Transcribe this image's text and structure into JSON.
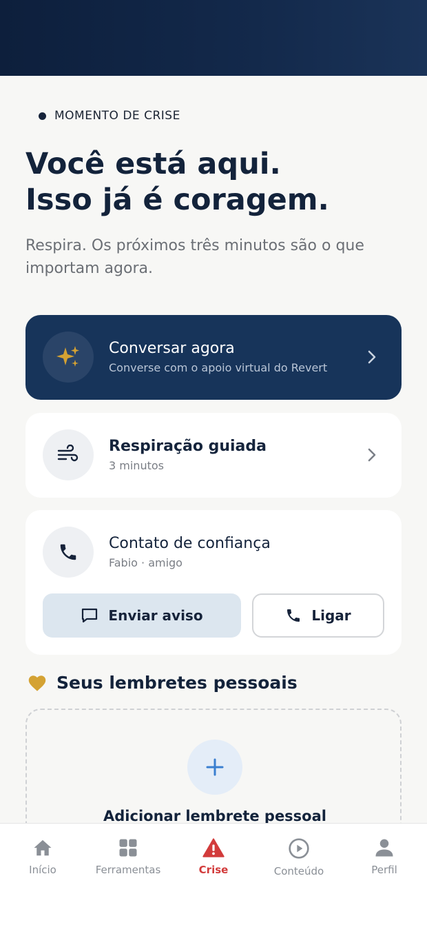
{
  "header": {
    "eyebrow": "MOMENTO DE CRISE",
    "title_line1": "Você está aqui.",
    "title_line2": "Isso já é coragem.",
    "subtitle": "Respira. Os próximos três minutos são o que importam agora."
  },
  "cards": {
    "chat": {
      "title": "Conversar agora",
      "subtitle": "Converse com o apoio virtual do Revert"
    },
    "breathing": {
      "title": "Respiração guiada",
      "subtitle": "3 minutos"
    },
    "contact": {
      "title": "Contato de confiança",
      "subtitle": "Fabio · amigo",
      "notify_label": "Enviar aviso",
      "call_label": "Ligar"
    }
  },
  "reminders": {
    "title": "Seus lembretes pessoais",
    "add_label": "Adicionar lembrete pessoal"
  },
  "nav": {
    "items": [
      {
        "label": "Início",
        "icon": "home-icon"
      },
      {
        "label": "Ferramentas",
        "icon": "grid-icon"
      },
      {
        "label": "Crise",
        "icon": "warning-icon"
      },
      {
        "label": "Conteúdo",
        "icon": "play-circle-icon"
      },
      {
        "label": "Perfil",
        "icon": "person-icon"
      }
    ],
    "active": "Crise"
  },
  "colors": {
    "primary_dark": "#17345a",
    "accent_gold": "#d4a233",
    "active_red": "#d23b3b",
    "text_dark": "#13233b"
  }
}
